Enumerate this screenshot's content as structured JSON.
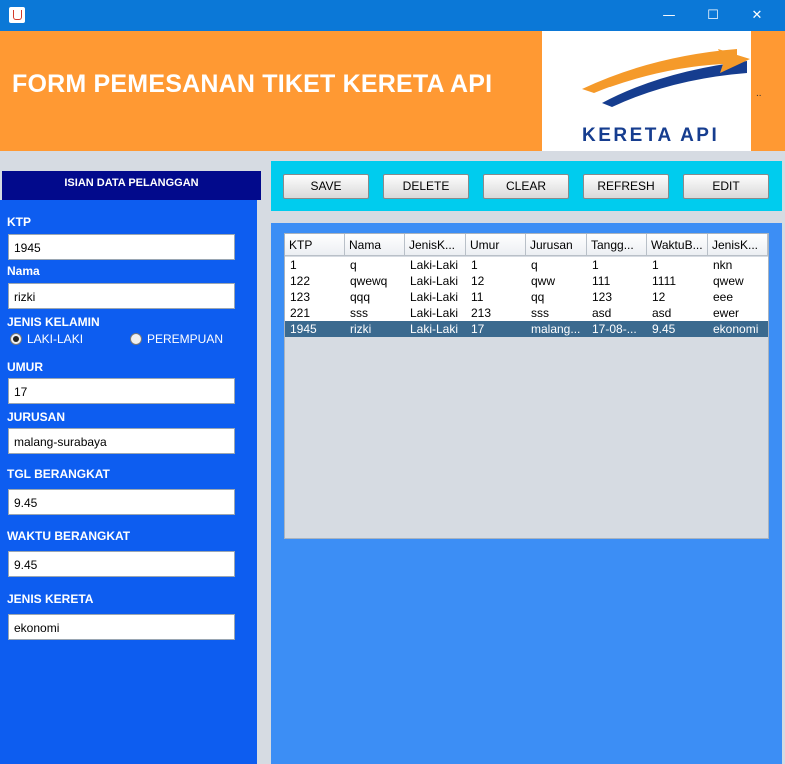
{
  "window": {
    "minimize_glyph": "—",
    "maximize_glyph": "☐",
    "close_glyph": "✕"
  },
  "header": {
    "title": "FORM PEMESANAN TIKET KERETA API",
    "logo_text": "KERETA API",
    "dots": ".."
  },
  "form": {
    "section_title": "ISIAN DATA PELANGGAN",
    "ktp": {
      "label": "KTP",
      "value": "1945"
    },
    "nama": {
      "label": "Nama",
      "value": "rizki"
    },
    "jenis_kelamin": {
      "label": "JENIS KELAMIN",
      "option_male": "LAKI-LAKI",
      "option_female": "PEREMPUAN",
      "selected": "LAKI-LAKI"
    },
    "umur": {
      "label": "UMUR",
      "value": "17"
    },
    "jurusan": {
      "label": "JURUSAN",
      "value": "malang-surabaya"
    },
    "tgl_berangkat": {
      "label": "TGL BERANGKAT",
      "value": "9.45"
    },
    "waktu_berangkat": {
      "label": "WAKTU BERANGKAT",
      "value": "9.45"
    },
    "jenis_kereta": {
      "label": "JENIS KERETA",
      "value": "ekonomi"
    }
  },
  "toolbar": {
    "save": "SAVE",
    "delete": "DELETE",
    "clear": "CLEAR",
    "refresh": "REFRESH",
    "edit": "EDIT"
  },
  "table": {
    "columns": [
      "KTP",
      "Nama",
      "JenisK...",
      "Umur",
      "Jurusan",
      "Tangg...",
      "WaktuB...",
      "JenisK..."
    ],
    "rows": [
      [
        "1",
        "q",
        "Laki-Laki",
        "1",
        "q",
        "1",
        "1",
        "nkn"
      ],
      [
        "122",
        "qwewq",
        "Laki-Laki",
        "12",
        "qww",
        "111",
        "1111",
        "qwew"
      ],
      [
        "123",
        "qqq",
        "Laki-Laki",
        "11",
        "qq",
        "123",
        "12",
        "eee"
      ],
      [
        "221",
        "sss",
        "Laki-Laki",
        "213",
        "sss",
        "asd",
        "asd",
        "ewer"
      ],
      [
        "1945",
        "rizki",
        "Laki-Laki",
        "17",
        "malang...",
        "17-08-...",
        "9.45",
        "ekonomi"
      ]
    ],
    "selected_row": 4
  },
  "colors": {
    "header_orange": "#ff9933",
    "left_panel_blue": "#0d5df0",
    "content_blue": "#3c8ef5",
    "toolbar_cyan": "#00ccee",
    "selection": "#3b6a8f"
  }
}
